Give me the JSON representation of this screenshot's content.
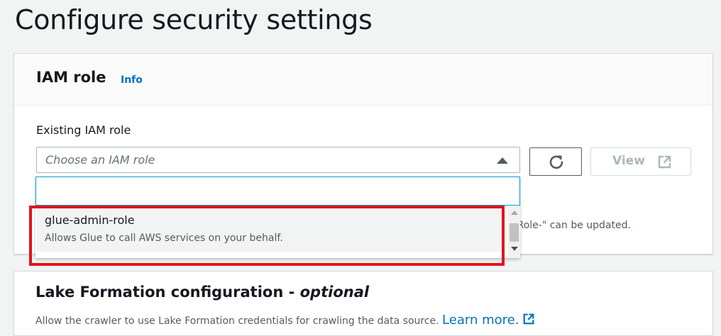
{
  "page": {
    "title": "Configure security settings"
  },
  "iam_panel": {
    "title": "IAM role",
    "info_link": "Info",
    "field_label": "Existing IAM role",
    "select_placeholder": "Choose an IAM role",
    "view_button": "View",
    "hint_text": "eRole-\" can be updated."
  },
  "dropdown": {
    "search_value": "",
    "options": [
      {
        "title": "glue-admin-role",
        "description": "Allows Glue to call AWS services on your behalf."
      }
    ]
  },
  "lake_panel": {
    "title": "Lake Formation configuration - ",
    "title_optional": "optional",
    "description": "Allow the crawler to use Lake Formation credentials for crawling the data source. ",
    "learn_more": "Learn more."
  },
  "icons": {
    "caret": "caret-up-icon",
    "refresh": "refresh-icon",
    "external": "external-link-icon",
    "search": "search-icon"
  },
  "colors": {
    "link": "#0073bb",
    "focus": "#00a1c9",
    "highlight": "#e0141e",
    "background": "#f2f3f3"
  }
}
